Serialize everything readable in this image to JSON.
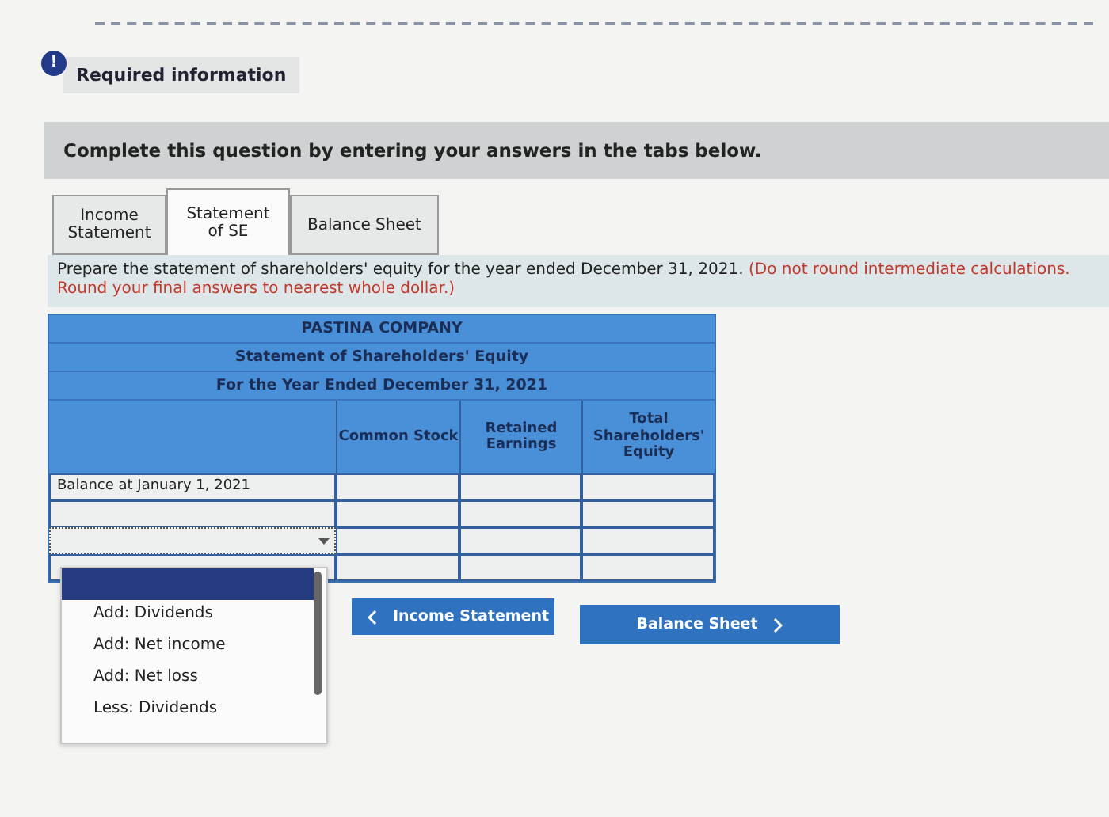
{
  "notice": {
    "icon": "!",
    "title": "Required information"
  },
  "instruction": "Complete this question by entering your answers in the tabs below.",
  "tabs": [
    {
      "label": "Income Statement",
      "selected": false
    },
    {
      "label": "Statement of SE",
      "selected": true
    },
    {
      "label": "Balance Sheet",
      "selected": false
    }
  ],
  "prompt": {
    "text": "Prepare the statement of shareholders' equity for the year ended December 31, 2021.",
    "note": "(Do not round intermediate calculations. Round your final answers to nearest whole dollar.)"
  },
  "table": {
    "titles": [
      "PASTINA COMPANY",
      "Statement of Shareholders' Equity",
      "For the Year Ended December 31, 2021"
    ],
    "columns": [
      "Common Stock",
      "Retained Earnings",
      "Total Shareholders' Equity"
    ],
    "rows": [
      {
        "kind": "text",
        "label": "Balance at January 1, 2021"
      },
      {
        "kind": "input"
      },
      {
        "kind": "select",
        "focused": true
      },
      {
        "kind": "covered"
      }
    ]
  },
  "dropdown": {
    "blank_highlighted": true,
    "options": [
      {
        "label": "Add: Dividends"
      },
      {
        "label": "Add: Net income"
      },
      {
        "label": "Add: Net loss"
      },
      {
        "label": "Less: Dividends"
      }
    ]
  },
  "buttons": [
    {
      "label": "Income Statement",
      "kind": "prev"
    },
    {
      "label": "Balance Sheet",
      "kind": "next"
    }
  ]
}
